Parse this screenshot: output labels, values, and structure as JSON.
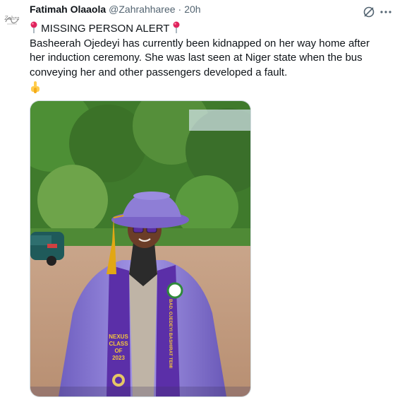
{
  "tweet": {
    "author": {
      "display_name": "Fatimah Olaaola",
      "handle": "@Zahrahharee",
      "separator": "·",
      "timestamp": "20h",
      "avatar_text": "Zahra"
    },
    "text_lines": [
      "MISSING PERSON ALERT",
      "Basheerah Ojedeyi has currently been kidnapped on her way home after",
      "her induction ceremony. She was last seen at Niger state when the bus",
      "conveying her and other passengers developed a fault."
    ],
    "icons": {
      "pin": "round-pushpin-icon",
      "point": "backhand-index-pointing-down-icon",
      "grok": "grok-icon",
      "more": "more-icon"
    },
    "media": {
      "stole_text": [
        "NEXUS",
        "CLASS",
        "OF",
        "2023"
      ],
      "stole_side_text": "BAD. OJEDEYI BASHIRAT TEMI"
    },
    "colors": {
      "gown": "#8e7ed6",
      "stole": "#5b2fa8",
      "tassel": "#e2a714",
      "text": "#0f1419",
      "muted": "#536471"
    }
  }
}
